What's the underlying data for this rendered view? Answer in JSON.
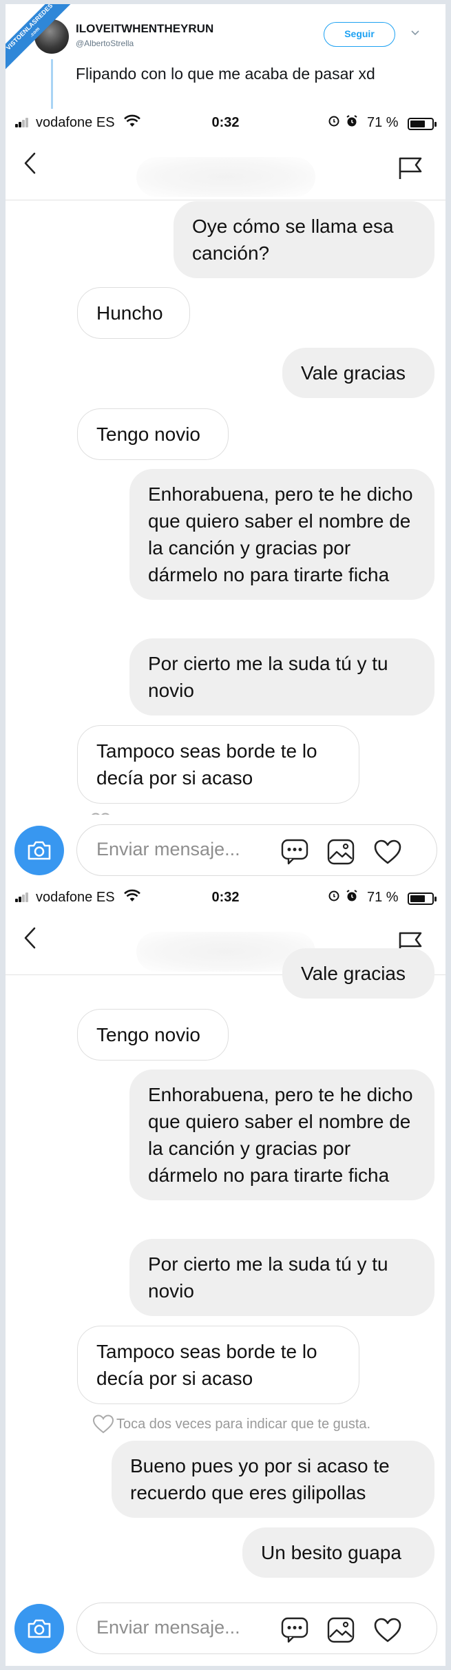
{
  "ribbon": {
    "line1": "VISTOENLASREDES",
    "line2": ".com"
  },
  "tweet": {
    "name": "ILOVEITWHENTHEYRUN",
    "handle": "@AlbertoStrella",
    "follow_label": "Seguir",
    "menu_icon": "chevron-down-icon",
    "text": "Flipando con lo que me acaba de pasar xd"
  },
  "status_bar": {
    "carrier": "vodafone ES",
    "time": "0:32",
    "battery": "71 %",
    "battery_level": 0.71
  },
  "screenshot_1": {
    "messages": [
      {
        "side": "out",
        "text": "Oye cómo se llama esa canción?"
      },
      {
        "side": "in",
        "text": "Huncho"
      },
      {
        "side": "out",
        "text": "Vale gracias"
      },
      {
        "side": "in",
        "text": "Tengo novio"
      },
      {
        "side": "out",
        "text": "Enhorabuena, pero te he dicho que quiero saber el nombre de la canción y gracias por dármelo no para tirarte ficha"
      },
      {
        "side": "out",
        "text": "Por cierto me la suda tú y tu novio"
      },
      {
        "side": "in",
        "text": "Tampoco seas borde te lo decía por si acaso"
      }
    ]
  },
  "screenshot_2": {
    "messages": [
      {
        "side": "out",
        "text": "Vale gracias"
      },
      {
        "side": "in",
        "text": "Tengo novio"
      },
      {
        "side": "out",
        "text": "Enhorabuena, pero te he dicho que quiero saber el nombre de la canción y gracias por dármelo no para tirarte ficha"
      },
      {
        "side": "out",
        "text": "Por cierto me la suda tú y tu novio"
      },
      {
        "side": "in",
        "text": "Tampoco seas borde te lo decía por si acaso"
      },
      {
        "side": "out",
        "text": "Bueno pues yo por si acaso te recuerdo que eres gilipollas"
      },
      {
        "side": "out",
        "text": "Un besito guapa"
      }
    ],
    "like_hint": "Toca dos veces para indicar que te gusta."
  },
  "composer": {
    "placeholder": "Enviar mensaje..."
  },
  "colors": {
    "accent": "#3897f0",
    "twitter_blue": "#1da1f2",
    "bubble_out": "#efefef",
    "ribbon": "#2f87d8"
  }
}
